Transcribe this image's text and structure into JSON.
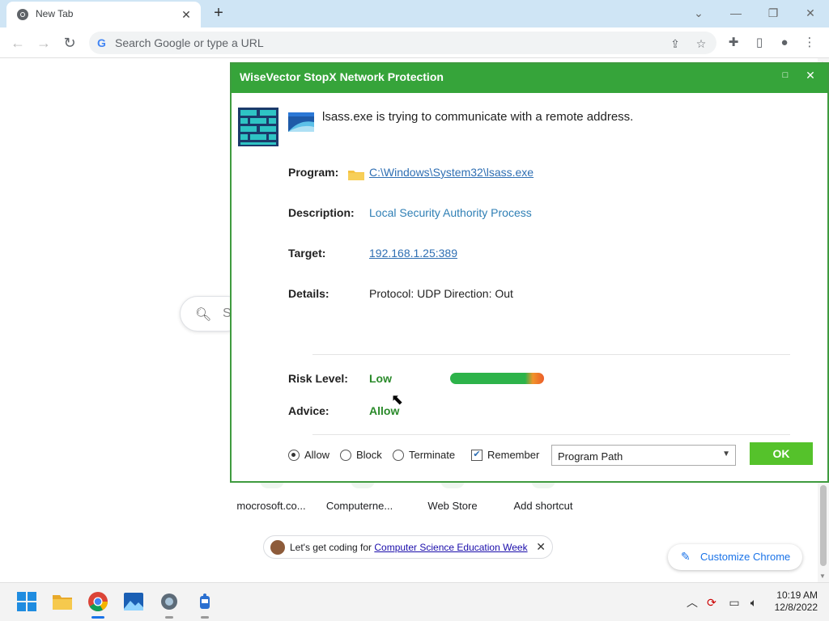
{
  "browser": {
    "tab_title": "New Tab",
    "omnibox_placeholder": "Search Google or type a URL",
    "omnibox_g": "G"
  },
  "ntp": {
    "search_partial": "S",
    "shortcuts": [
      {
        "label": "mocrosoft.co..."
      },
      {
        "label": "Computerne..."
      },
      {
        "label": "Web Store"
      },
      {
        "label": "Add shortcut"
      }
    ],
    "promo": {
      "text": "Let's get coding for ",
      "link": "Computer Science Education Week"
    },
    "customize_label": "Customize Chrome"
  },
  "dialog": {
    "title": "WiseVector StopX Network Protection",
    "message": "lsass.exe is trying to communicate with a remote address.",
    "program_label": "Program:",
    "program_value": "C:\\Windows\\System32\\lsass.exe",
    "description_label": "Description:",
    "description_value": "Local Security Authority Process",
    "target_label": "Target:",
    "target_value": "192.168.1.25:389",
    "details_label": "Details:",
    "details_value": "Protocol: UDP Direction: Out",
    "risk_label": "Risk Level:",
    "risk_value": "Low",
    "advice_label": "Advice:",
    "advice_value": "Allow",
    "options": {
      "allow": "Allow",
      "block": "Block",
      "terminate": "Terminate",
      "remember": "Remember",
      "selected": "Allow",
      "remember_checked": true
    },
    "rule_select": "Program Path",
    "ok_label": "OK"
  },
  "taskbar": {
    "time": "10:19 AM",
    "date": "12/8/2022"
  },
  "colors": {
    "dialog_green": "#36a43a",
    "ok_green": "#55c22b",
    "link_blue": "#2f6fb3",
    "risk_low": "#2a8a2a"
  }
}
